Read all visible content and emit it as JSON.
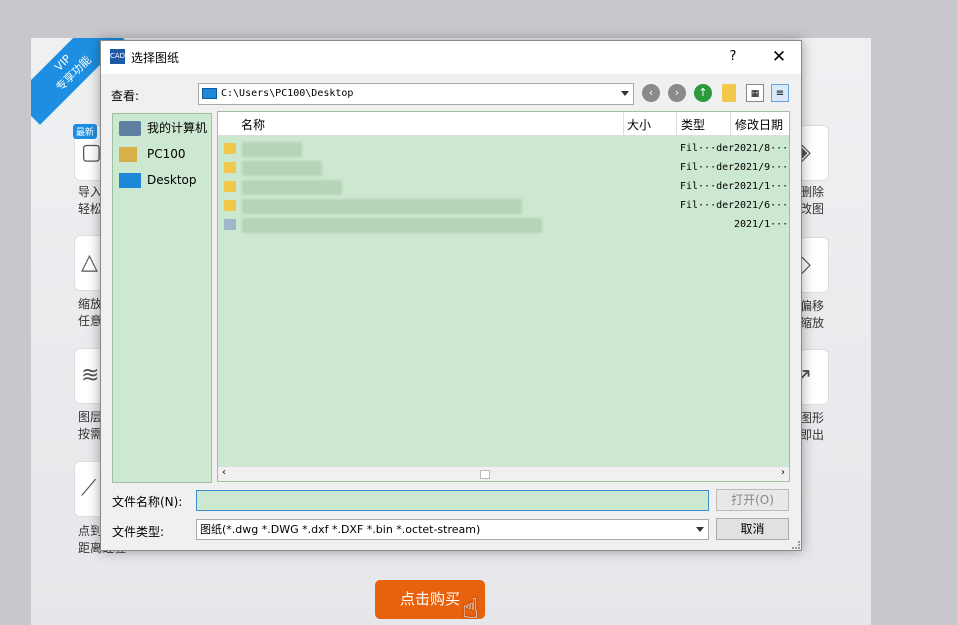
{
  "background": {
    "vip_ribbon": "VIP\n专享功能",
    "new_badge": "最新",
    "tiles": [
      {
        "label": "导入\n轻松"
      },
      {
        "label": "缩放\n任意"
      },
      {
        "label": "图层\n按需"
      },
      {
        "label": "点到\n距离蛙驻"
      },
      {
        "label": "删除\n改图"
      },
      {
        "label": "偏移\n缩放"
      },
      {
        "label": "图形\n即出"
      }
    ],
    "buy_button": "点击购买"
  },
  "dialog": {
    "title": "选择图纸",
    "help": "?",
    "close": "✕",
    "look_in_label": "查看:",
    "path": "C:\\Users\\PC100\\Desktop",
    "places": [
      {
        "label": "我的计算机"
      },
      {
        "label": "PC100"
      },
      {
        "label": "Desktop"
      }
    ],
    "columns": [
      "名称",
      "大小",
      "类型",
      "修改日期"
    ],
    "files": [
      {
        "type": "Fil···der",
        "date": "2021/8···:"
      },
      {
        "type": "Fil···der",
        "date": "2021/9···:"
      },
      {
        "type": "Fil···der",
        "date": "2021/1···:"
      },
      {
        "type": "Fil···der",
        "date": "2021/6···:"
      },
      {
        "type": "",
        "date": "2021/1···:"
      }
    ],
    "filename_label": "文件名称(N):",
    "filename_value": "",
    "open_button": "打开(O)",
    "filetype_label": "文件类型:",
    "filetype_value": "图纸(*.dwg *.DWG *.dxf *.DXF *.bin *.octet-stream)",
    "cancel_button": "取消"
  }
}
